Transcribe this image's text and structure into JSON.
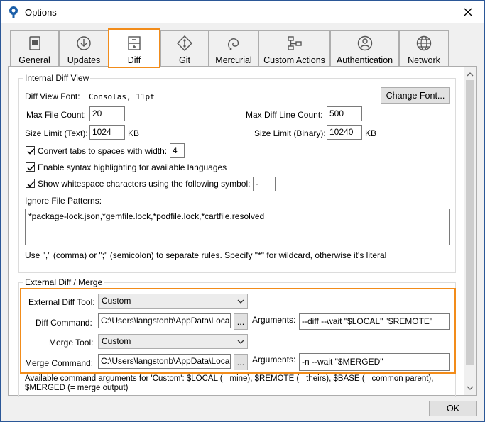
{
  "window": {
    "title": "Options"
  },
  "tabs": [
    {
      "label": "General",
      "icon": "general-icon"
    },
    {
      "label": "Updates",
      "icon": "updates-icon"
    },
    {
      "label": "Diff",
      "icon": "diff-icon",
      "selected": true
    },
    {
      "label": "Git",
      "icon": "git-icon"
    },
    {
      "label": "Mercurial",
      "icon": "mercurial-icon"
    },
    {
      "label": "Custom Actions",
      "icon": "custom-actions-icon"
    },
    {
      "label": "Authentication",
      "icon": "authentication-icon"
    },
    {
      "label": "Network",
      "icon": "network-icon"
    }
  ],
  "internal": {
    "title": "Internal Diff View",
    "font_label": "Diff View Font:",
    "font_value": "Consolas, 11pt",
    "change_font": "Change Font...",
    "max_file_count_label": "Max File Count:",
    "max_file_count": "20",
    "max_diff_line_label": "Max Diff Line Count:",
    "max_diff_line": "500",
    "size_limit_text_label": "Size Limit (Text):",
    "size_limit_text": "1024",
    "size_limit_text_unit": "KB",
    "size_limit_binary_label": "Size Limit (Binary):",
    "size_limit_binary": "10240",
    "size_limit_binary_unit": "KB",
    "convert_tabs_label": "Convert tabs to spaces with width:",
    "convert_tabs_width": "4",
    "syntax_label": "Enable syntax highlighting for available languages",
    "whitespace_label": "Show whitespace characters using the following symbol:",
    "whitespace_symbol": "·",
    "ignore_label": "Ignore File Patterns:",
    "ignore_value": "*package-lock.json,*gemfile.lock,*podfile.lock,*cartfile.resolved",
    "hint": "Use \",\" (comma) or \";\" (semicolon) to separate rules. Specify \"*\" for wildcard, otherwise it's literal"
  },
  "external": {
    "title": "External Diff / Merge",
    "diff_tool_label": "External Diff Tool:",
    "diff_tool": "Custom",
    "diff_command_label": "Diff Command:",
    "diff_command": "C:\\Users\\langstonb\\AppData\\Local",
    "browse": "...",
    "arguments_label": "Arguments:",
    "diff_arguments": "--diff --wait \"$LOCAL\" \"$REMOTE\"",
    "merge_tool_label": "Merge Tool:",
    "merge_tool": "Custom",
    "merge_command_label": "Merge Command:",
    "merge_command": "C:\\Users\\langstonb\\AppData\\Local",
    "merge_arguments": "-n --wait \"$MERGED\"",
    "available_1": "Available command arguments for 'Custom': $LOCAL (= mine), $REMOTE (= theirs), $BASE (= common parent),",
    "available_2": "$MERGED (= merge output)"
  },
  "footer": {
    "ok": "OK"
  },
  "colors": {
    "highlight": "#f28c1a",
    "accent": "#2b5797"
  }
}
